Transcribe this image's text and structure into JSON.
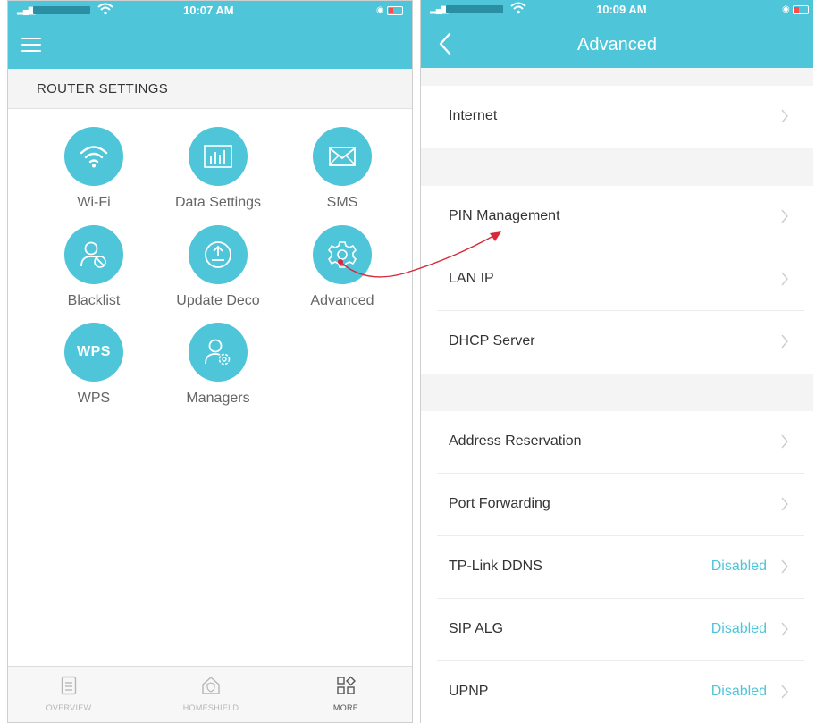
{
  "left": {
    "status": {
      "time": "10:07 AM"
    },
    "section_title": "ROUTER SETTINGS",
    "tiles": [
      {
        "label": "Wi-Fi",
        "icon": "wifi-icon"
      },
      {
        "label": "Data Settings",
        "icon": "bar-chart-icon"
      },
      {
        "label": "SMS",
        "icon": "envelope-icon"
      },
      {
        "label": "Blacklist",
        "icon": "blocked-user-icon"
      },
      {
        "label": "Update Deco",
        "icon": "upload-icon"
      },
      {
        "label": "Advanced",
        "icon": "gear-icon"
      },
      {
        "label": "WPS",
        "icon_text": "WPS"
      },
      {
        "label": "Managers",
        "icon": "user-gear-icon"
      }
    ],
    "tabs": [
      {
        "label": "OVERVIEW",
        "icon": "document-icon",
        "active": false
      },
      {
        "label": "HOMESHIELD",
        "icon": "home-shield-icon",
        "active": false
      },
      {
        "label": "MORE",
        "icon": "grid-icon",
        "active": true
      }
    ]
  },
  "right": {
    "status": {
      "time": "10:09 AM"
    },
    "title": "Advanced",
    "rows": [
      {
        "label": "Internet"
      },
      {
        "label": "PIN Management"
      },
      {
        "label": "LAN IP"
      },
      {
        "label": "DHCP Server"
      },
      {
        "label": "Address Reservation"
      },
      {
        "label": "Port Forwarding"
      },
      {
        "label": "TP-Link DDNS",
        "value": "Disabled"
      },
      {
        "label": "SIP ALG",
        "value": "Disabled"
      },
      {
        "label": "UPNP",
        "value": "Disabled"
      }
    ]
  },
  "colors": {
    "accent": "#4ec5d8",
    "arrow": "#d9283a",
    "muted_text": "#666666"
  }
}
